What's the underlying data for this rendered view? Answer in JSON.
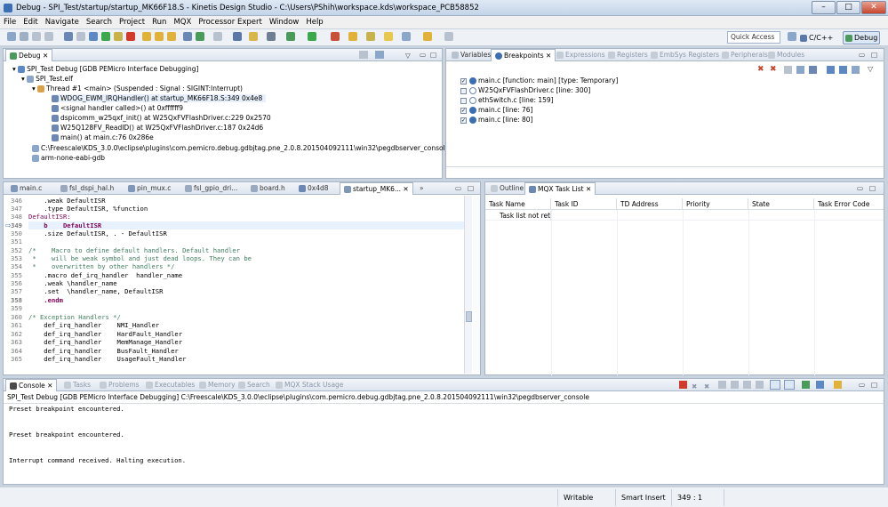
{
  "window": {
    "title": "Debug - SPI_Test/startup/startup_MK66F18.S - Kinetis Design Studio - C:\\Users\\PShih\\workspace.kds\\workspace_PCB58852"
  },
  "menu": [
    "File",
    "Edit",
    "Navigate",
    "Search",
    "Project",
    "Run",
    "MQX",
    "Processor Expert",
    "Window",
    "Help"
  ],
  "toolbar": {
    "quick_access_placeholder": "Quick Access",
    "perspectives": [
      "C/C++",
      "Debug"
    ]
  },
  "debug_view": {
    "tab": "Debug",
    "tree": [
      "SPI_Test Debug [GDB PEMicro Interface Debugging]",
      "SPI_Test.elf",
      "Thread #1 <main> (Suspended : Signal : SIGINT:Interrupt)",
      "WDOG_EWM_IRQHandler() at startup_MK66F18.S:349 0x4e8",
      "<signal handler called>() at 0xffffff9",
      "dspicomm_w25qxf_init() at W25QxFVFlashDriver.c:229 0x2570",
      "W25Q128FV_ReadID() at W25QxFVFlashDriver.c:187 0x24d6",
      "main() at main.c:76 0x286e",
      "C:\\Freescale\\KDS_3.0.0\\eclipse\\plugins\\com.pemicro.debug.gdbjtag.pne_2.0.8.201504092111\\win32\\pegdbserver_console",
      "arm-none-eabi-gdb"
    ]
  },
  "breakpoints_view": {
    "tabs": [
      "Variables",
      "Breakpoints",
      "Expressions",
      "Registers",
      "EmbSys Registers",
      "Peripherals",
      "Modules"
    ],
    "items": [
      {
        "label": "main.c [function: main] [type: Temporary]",
        "checked": true
      },
      {
        "label": "W25QxFVFlashDriver.c [line: 300]",
        "checked": false
      },
      {
        "label": "ethSwitch.c [line: 159]",
        "checked": false
      },
      {
        "label": "main.c [line: 76]",
        "checked": true
      },
      {
        "label": "main.c [line: 80]",
        "checked": true
      }
    ]
  },
  "editor": {
    "tabs": [
      "main.c",
      "fsl_dspi_hal.h",
      "pin_mux.c",
      "fsl_gpio_dri...",
      "board.h",
      "0x4d8",
      "startup_MK6..."
    ],
    "lines": [
      {
        "n": "346",
        "text": "    .weak DefaultISR"
      },
      {
        "n": "347",
        "text": "    .type DefaultISR, %function"
      },
      {
        "n": "348",
        "text": "DefaultISR:"
      },
      {
        "n": "349",
        "text": "    b    DefaultISR"
      },
      {
        "n": "350",
        "text": "    .size DefaultISR, . - DefaultISR"
      },
      {
        "n": "351",
        "text": ""
      },
      {
        "n": "352",
        "text": "/*    Macro to define default handlers. Default handler"
      },
      {
        "n": "353",
        "text": " *    will be weak symbol and just dead loops. They can be"
      },
      {
        "n": "354",
        "text": " *    overwritten by other handlers */"
      },
      {
        "n": "355",
        "text": "    .macro def_irq_handler  handler_name"
      },
      {
        "n": "356",
        "text": "    .weak \\handler_name"
      },
      {
        "n": "357",
        "text": "    .set  \\handler_name, DefaultISR"
      },
      {
        "n": "358",
        "text": "    .endm"
      },
      {
        "n": "359",
        "text": ""
      },
      {
        "n": "360",
        "text": "/* Exception Handlers */"
      },
      {
        "n": "361",
        "text": "    def_irq_handler    NMI_Handler"
      },
      {
        "n": "362",
        "text": "    def_irq_handler    HardFault_Handler"
      },
      {
        "n": "363",
        "text": "    def_irq_handler    MemManage_Handler"
      },
      {
        "n": "364",
        "text": "    def_irq_handler    BusFault_Handler"
      },
      {
        "n": "365",
        "text": "    def_irq_handler    UsageFault_Handler"
      }
    ]
  },
  "mqx_view": {
    "tabs": [
      "Outline",
      "MQX Task List"
    ],
    "columns": [
      "Task Name",
      "Task ID",
      "TD Address",
      "Priority",
      "State",
      "Task Error Code"
    ],
    "message": "Task list not retrie"
  },
  "console_view": {
    "tabs": [
      "Console",
      "Tasks",
      "Problems",
      "Executables",
      "Memory",
      "Search",
      "MQX Stack Usage"
    ],
    "header": "SPI_Test Debug [GDB PEMicro Interface Debugging] C:\\Freescale\\KDS_3.0.0\\eclipse\\plugins\\com.pemicro.debug.gdbjtag.pne_2.0.8.201504092111\\win32\\pegdbserver_console",
    "lines": [
      "Preset breakpoint encountered.",
      "",
      "",
      "Preset breakpoint encountered.",
      "",
      "",
      "Interrupt command received. Halting execution."
    ]
  },
  "status": {
    "writable": "Writable",
    "insert": "Smart Insert",
    "position": "349 : 1"
  },
  "colors": {
    "accent": "#3c6eb4",
    "highlight": "#e8f0fc",
    "keyword": "#7f0055",
    "comment": "#3f7f5f"
  }
}
